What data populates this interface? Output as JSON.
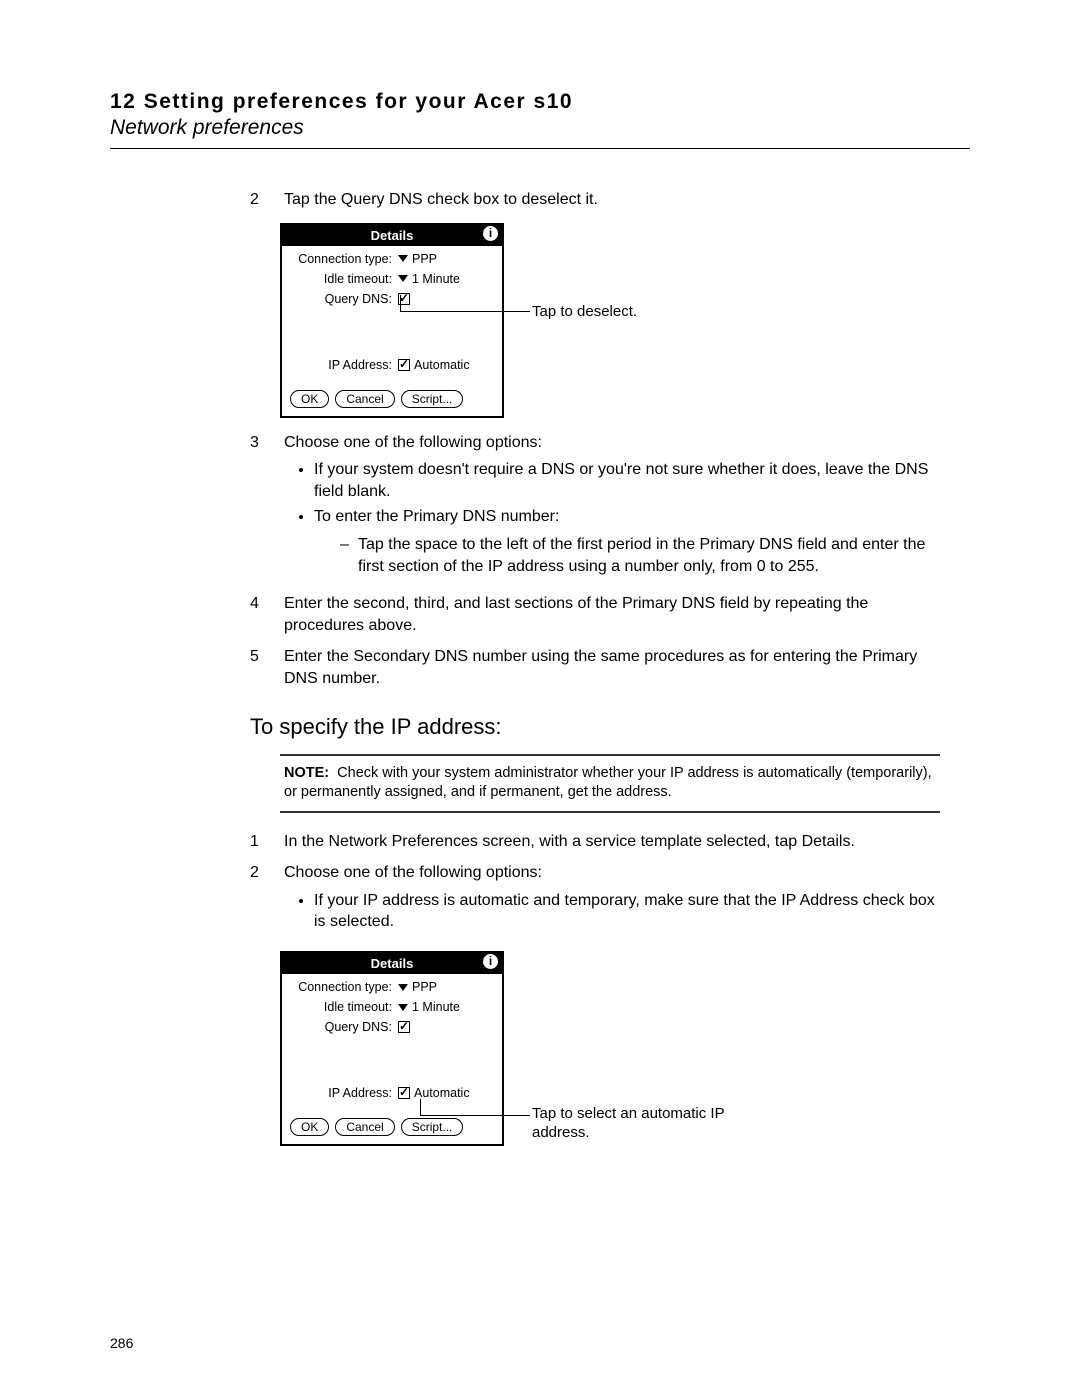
{
  "header": {
    "chapter_line": "12 Setting preferences for your Acer s10",
    "section_line": "Network preferences"
  },
  "step2": {
    "num": "2",
    "text": "Tap the Query DNS check box to deselect it."
  },
  "fig1": {
    "title": "Details",
    "info_glyph": "i",
    "conn_label": "Connection type:",
    "conn_value": "PPP",
    "idle_label": "Idle timeout:",
    "idle_value": "1 Minute",
    "dns_label": "Query DNS:",
    "ip_label": "IP Address:",
    "ip_value": "Automatic",
    "btn_ok": "OK",
    "btn_cancel": "Cancel",
    "btn_script": "Script...",
    "callout": "Tap to deselect."
  },
  "step3": {
    "num": "3",
    "text": "Choose one of the following options:",
    "b1": "If your system doesn't require a DNS or you're not sure whether it does, leave the DNS field blank.",
    "b2": "To enter the Primary DNS number:",
    "d1": "Tap the space to the left of the first period in the Primary DNS field and enter the first section of the IP address using a number only, from 0 to 255."
  },
  "step4": {
    "num": "4",
    "text": "Enter the second, third, and last sections of the Primary DNS field by repeating the procedures above."
  },
  "step5": {
    "num": "5",
    "text": "Enter the Secondary DNS number using the same procedures as for entering the Primary DNS number."
  },
  "subhead": "To specify the IP address:",
  "note": {
    "label": "NOTE:",
    "text": "Check with your system administrator whether your IP address is automatically (temporarily), or permanently assigned, and if permanent, get the address."
  },
  "ip_step1": {
    "num": "1",
    "text": "In the Network Preferences screen, with a service template selected, tap Details."
  },
  "ip_step2": {
    "num": "2",
    "text": "Choose one of the following options:",
    "b1": "If your IP address is automatic and temporary, make sure that the IP Address check box is selected."
  },
  "fig2": {
    "title": "Details",
    "info_glyph": "i",
    "conn_label": "Connection type:",
    "conn_value": "PPP",
    "idle_label": "Idle timeout:",
    "idle_value": "1 Minute",
    "dns_label": "Query DNS:",
    "ip_label": "IP Address:",
    "ip_value": "Automatic",
    "btn_ok": "OK",
    "btn_cancel": "Cancel",
    "btn_script": "Script...",
    "callout": "Tap to select an automatic IP address."
  },
  "page_number": "286"
}
